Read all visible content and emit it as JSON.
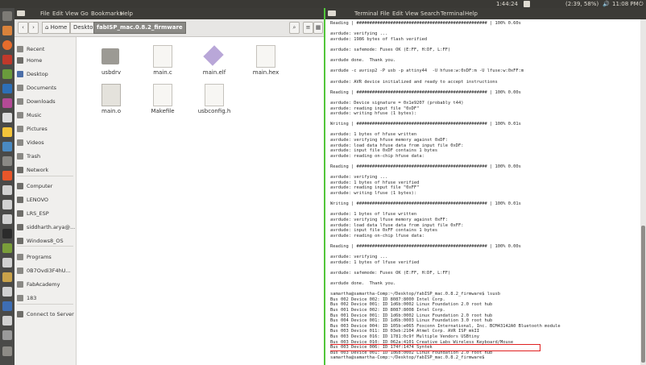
{
  "top_panel": {
    "time_left": "1:44:24",
    "battery": "(2:39, 58%)",
    "volume_icon": "volume-icon",
    "clock": "11:08 PM",
    "gear_icon": "gear-icon"
  },
  "file_manager": {
    "menu": [
      "File",
      "Edit",
      "View",
      "Go",
      "Bookmarks",
      "Help"
    ],
    "breadcrumb": [
      "Home",
      "Desktop",
      "fabISP_mac.0.8.2_firmware"
    ],
    "sidebar": [
      {
        "label": "Recent",
        "icon": "clock-icon"
      },
      {
        "label": "Home",
        "icon": "home-icon"
      },
      {
        "label": "Desktop",
        "icon": "desktop-icon"
      },
      {
        "label": "Documents",
        "icon": "folder-icon"
      },
      {
        "label": "Downloads",
        "icon": "download-icon"
      },
      {
        "label": "Music",
        "icon": "music-icon"
      },
      {
        "label": "Pictures",
        "icon": "picture-icon"
      },
      {
        "label": "Videos",
        "icon": "video-icon"
      },
      {
        "label": "Trash",
        "icon": "trash-icon"
      },
      {
        "label": "Network",
        "icon": "network-icon"
      },
      {
        "label": "Computer",
        "icon": "drive-icon"
      },
      {
        "label": "LENOVO",
        "icon": "drive-icon"
      },
      {
        "label": "LRS_ESP",
        "icon": "drive-icon"
      },
      {
        "label": "siddharth.arya@...",
        "icon": "drive-icon"
      },
      {
        "label": "Windows8_OS",
        "icon": "drive-icon"
      },
      {
        "label": "Programs",
        "icon": "folder-icon"
      },
      {
        "label": "0B7Ovdi3F4hU...",
        "icon": "folder-icon"
      },
      {
        "label": "FabAcademy",
        "icon": "folder-icon"
      },
      {
        "label": "183",
        "icon": "folder-icon"
      },
      {
        "label": "Connect to Server",
        "icon": "server-icon"
      }
    ],
    "files": [
      {
        "name": "usbdrv",
        "type": "folder"
      },
      {
        "name": "main.c",
        "type": "text"
      },
      {
        "name": "main.elf",
        "type": "binary"
      },
      {
        "name": "main.hex",
        "type": "text"
      },
      {
        "name": "main.o",
        "type": "object"
      },
      {
        "name": "Makefile",
        "type": "text"
      },
      {
        "name": "usbconfig.h",
        "type": "text"
      }
    ]
  },
  "terminal": {
    "menu": [
      "Terminal",
      "File",
      "Edit",
      "View",
      "Search",
      "Terminal",
      "Help"
    ],
    "lines": [
      "Reading | ################################################## | 100% 0.60s",
      "",
      "avrdude: verifying ...",
      "avrdude: 1986 bytes of flash verified",
      "",
      "avrdude: safemode: Fuses OK (E:FF, H:DF, L:FF)",
      "",
      "avrdude done.  Thank you.",
      "",
      "avrdude -c avrisp2 -P usb -p attiny44  -U hfuse:w:0xDF:m -U lfuse:w:0xFF:m",
      "",
      "avrdude: AVR device initialized and ready to accept instructions",
      "",
      "Reading | ################################################## | 100% 0.00s",
      "",
      "avrdude: Device signature = 0x1e9207 (probably t44)",
      "avrdude: reading input file \"0xDF\"",
      "avrdude: writing hfuse (1 bytes):",
      "",
      "Writing | ################################################## | 100% 0.01s",
      "",
      "avrdude: 1 bytes of hfuse written",
      "avrdude: verifying hfuse memory against 0xDF:",
      "avrdude: load data hfuse data from input file 0xDF:",
      "avrdude: input file 0xDF contains 1 bytes",
      "avrdude: reading on-chip hfuse data:",
      "",
      "Reading | ################################################## | 100% 0.00s",
      "",
      "avrdude: verifying ...",
      "avrdude: 1 bytes of hfuse verified",
      "avrdude: reading input file \"0xFF\"",
      "avrdude: writing lfuse (1 bytes):",
      "",
      "Writing | ################################################## | 100% 0.01s",
      "",
      "avrdude: 1 bytes of lfuse written",
      "avrdude: verifying lfuse memory against 0xFF:",
      "avrdude: load data lfuse data from input file 0xFF:",
      "avrdude: input file 0xFF contains 1 bytes",
      "avrdude: reading on-chip lfuse data:",
      "",
      "Reading | ################################################## | 100% 0.00s",
      "",
      "avrdude: verifying ...",
      "avrdude: 1 bytes of lfuse verified",
      "",
      "avrdude: safemode: Fuses OK (E:FF, H:DF, L:FF)",
      "",
      "avrdude done.  Thank you.",
      "",
      "samartha@samartha-Comp:~/Desktop/fabISP_mac.0.8.2_firmware$ lsusb",
      "Bus 002 Device 002: ID 8087:8000 Intel Corp.",
      "Bus 002 Device 001: ID 1d6b:0002 Linux Foundation 2.0 root hub",
      "Bus 001 Device 002: ID 8087:8008 Intel Corp.",
      "Bus 001 Device 001: ID 1d6b:0002 Linux Foundation 2.0 root hub",
      "Bus 004 Device 001: ID 1d6b:0003 Linux Foundation 3.0 root hub",
      "Bus 003 Device 004: ID 105b:e065 Foxconn International, Inc. BCM43142A0 Bluetooth module",
      "Bus 003 Device 011: ID 03eb:2104 Atmel Corp. AVR ISP mkII",
      "Bus 003 Device 016: ID 1781:0c9f Multiple Vendors USBtiny",
      "Bus 003 Device 010: ID 062a:4101 Creative Labs Wireless Keyboard/Mouse",
      "Bus 003 Device 006: ID 174f:1474 Syntek",
      "Bus 003 Device 001: ID 1d6b:0002 Linux Foundation 2.0 root hub",
      "samartha@samartha-Comp:~/Desktop/fabISP_mac.0.8.2_firmware$ "
    ],
    "highlight_index": 61
  }
}
